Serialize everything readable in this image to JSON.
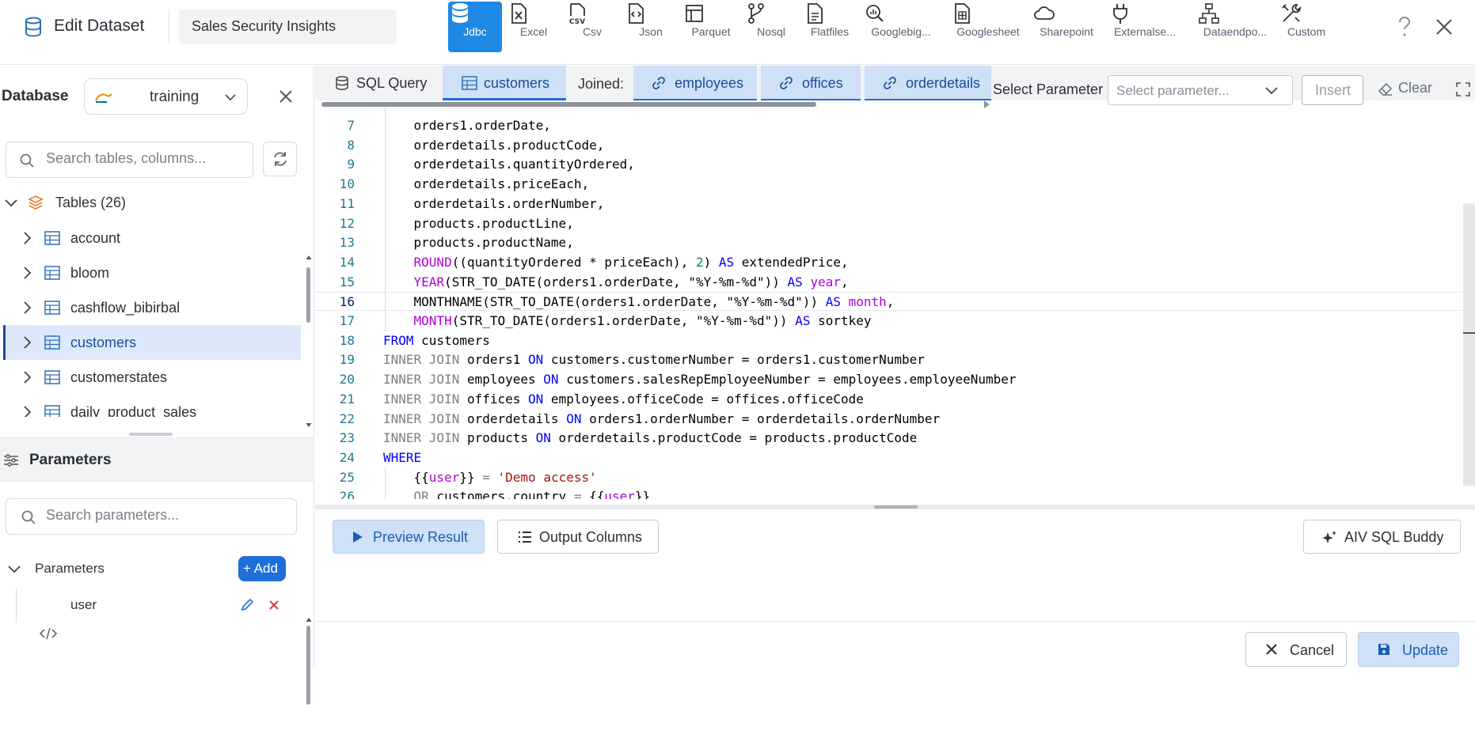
{
  "header": {
    "title": "Edit Dataset",
    "dataset_name": "Sales Security Insights",
    "sources": [
      {
        "label": "Jdbc",
        "icon": "database-icon",
        "active": true
      },
      {
        "label": "Excel",
        "icon": "excel-file-icon"
      },
      {
        "label": "Csv",
        "icon": "csv-file-icon"
      },
      {
        "label": "Json",
        "icon": "json-file-icon"
      },
      {
        "label": "Parquet",
        "icon": "parquet-icon"
      },
      {
        "label": "Nosql",
        "icon": "nosql-branch-icon"
      },
      {
        "label": "Flatfiles",
        "icon": "flatfile-icon"
      },
      {
        "label": "Googlebig...",
        "icon": "googlebigquery-icon"
      },
      {
        "label": "Googlesheet",
        "icon": "googlesheet-icon"
      },
      {
        "label": "Sharepoint",
        "icon": "sharepoint-cloud-icon"
      },
      {
        "label": "Externalse...",
        "icon": "plug-icon"
      },
      {
        "label": "Dataendpo...",
        "icon": "dataendpoint-icon"
      },
      {
        "label": "Custom",
        "icon": "tools-icon"
      }
    ]
  },
  "left": {
    "database_label": "Database",
    "database_value": "training",
    "table_search_placeholder": "Search tables, columns...",
    "tables_header": "Tables (26)",
    "tables": [
      {
        "label": "account"
      },
      {
        "label": "bloom"
      },
      {
        "label": "cashflow_bibirbal"
      },
      {
        "label": "customers",
        "selected": true
      },
      {
        "label": "customerstates"
      },
      {
        "label": "daily_product_sales"
      }
    ],
    "parameters_title": "Parameters",
    "param_search_placeholder": "Search parameters...",
    "param_group_label": "Parameters",
    "add_label": "+ Add",
    "params": [
      {
        "label": "user"
      }
    ]
  },
  "editor_tabs": {
    "sql_query": "SQL Query",
    "main_table": "customers",
    "joined_label": "Joined:",
    "joined": [
      "employees",
      "offices",
      "orderdetails"
    ],
    "select_parameter_label": "Select Parameter",
    "select_parameter_placeholder": "Select parameter...",
    "insert_label": "Insert",
    "clear_label": "Clear"
  },
  "code": {
    "current_line": 16,
    "lines": [
      {
        "n": 7,
        "tokens": [
          [
            "t",
            "    orders1.orderDate,"
          ]
        ]
      },
      {
        "n": 8,
        "tokens": [
          [
            "t",
            "    orderdetails.productCode,"
          ]
        ]
      },
      {
        "n": 9,
        "tokens": [
          [
            "t",
            "    orderdetails.quantityOrdered,"
          ]
        ]
      },
      {
        "n": 10,
        "tokens": [
          [
            "t",
            "    orderdetails.priceEach,"
          ]
        ]
      },
      {
        "n": 11,
        "tokens": [
          [
            "t",
            "    orderdetails.orderNumber,"
          ]
        ]
      },
      {
        "n": 12,
        "tokens": [
          [
            "t",
            "    products.productLine,"
          ]
        ]
      },
      {
        "n": 13,
        "tokens": [
          [
            "t",
            "    products.productName,"
          ]
        ]
      },
      {
        "n": 14,
        "tokens": [
          [
            "t",
            "    "
          ],
          [
            "fn",
            "ROUND"
          ],
          [
            "t",
            "((quantityOrdered * priceEach), "
          ],
          [
            "num",
            "2"
          ],
          [
            "t",
            ") "
          ],
          [
            "kw",
            "AS"
          ],
          [
            "t",
            " extendedPrice,"
          ]
        ]
      },
      {
        "n": 15,
        "tokens": [
          [
            "t",
            "    "
          ],
          [
            "fn",
            "YEAR"
          ],
          [
            "t",
            "(STR_TO_DATE(orders1.orderDate, \"%Y-%m-%d\")) "
          ],
          [
            "kw",
            "AS"
          ],
          [
            "t",
            " "
          ],
          [
            "fn",
            "year"
          ],
          [
            "t",
            ","
          ]
        ]
      },
      {
        "n": 16,
        "tokens": [
          [
            "t",
            "    MONTHNAME(STR_TO_DATE(orders1.orderDate, \"%Y-%m-%d\")) "
          ],
          [
            "kw",
            "AS"
          ],
          [
            "t",
            " "
          ],
          [
            "fn",
            "month"
          ],
          [
            "t",
            ","
          ]
        ]
      },
      {
        "n": 17,
        "tokens": [
          [
            "t",
            "    "
          ],
          [
            "fn",
            "MONTH"
          ],
          [
            "t",
            "(STR_TO_DATE(orders1.orderDate, \"%Y-%m-%d\")) "
          ],
          [
            "kw",
            "AS"
          ],
          [
            "t",
            " sortkey"
          ]
        ]
      },
      {
        "n": 18,
        "tokens": [
          [
            "kw",
            "FROM"
          ],
          [
            "t",
            " customers"
          ]
        ]
      },
      {
        "n": 19,
        "tokens": [
          [
            "kwg",
            "INNER JOIN"
          ],
          [
            "t",
            " orders1 "
          ],
          [
            "kw",
            "ON"
          ],
          [
            "t",
            " customers.customerNumber = orders1.customerNumber"
          ]
        ]
      },
      {
        "n": 20,
        "tokens": [
          [
            "kwg",
            "INNER JOIN"
          ],
          [
            "t",
            " employees "
          ],
          [
            "kw",
            "ON"
          ],
          [
            "t",
            " customers.salesRepEmployeeNumber = employees.employeeNumber"
          ]
        ]
      },
      {
        "n": 21,
        "tokens": [
          [
            "kwg",
            "INNER JOIN"
          ],
          [
            "t",
            " offices "
          ],
          [
            "kw",
            "ON"
          ],
          [
            "t",
            " employees.officeCode = offices.officeCode"
          ]
        ]
      },
      {
        "n": 22,
        "tokens": [
          [
            "kwg",
            "INNER JOIN"
          ],
          [
            "t",
            " orderdetails "
          ],
          [
            "kw",
            "ON"
          ],
          [
            "t",
            " orders1.orderNumber = orderdetails.orderNumber"
          ]
        ]
      },
      {
        "n": 23,
        "tokens": [
          [
            "kwg",
            "INNER JOIN"
          ],
          [
            "t",
            " products "
          ],
          [
            "kw",
            "ON"
          ],
          [
            "t",
            " orderdetails.productCode = products.productCode"
          ]
        ]
      },
      {
        "n": 24,
        "tokens": [
          [
            "kw",
            "WHERE"
          ]
        ]
      },
      {
        "n": 25,
        "tokens": [
          [
            "t",
            "    {{"
          ],
          [
            "fn",
            "user"
          ],
          [
            "t",
            "}} "
          ],
          [
            "kwg",
            "="
          ],
          [
            "t",
            " "
          ],
          [
            "str",
            "'Demo access'"
          ]
        ]
      },
      {
        "n": 26,
        "tokens": [
          [
            "t",
            "    "
          ],
          [
            "kwg",
            "OR"
          ],
          [
            "t",
            " customers.country "
          ],
          [
            "kwg",
            "="
          ],
          [
            "t",
            " {{"
          ],
          [
            "fn",
            "user"
          ],
          [
            "t",
            "}}"
          ]
        ]
      }
    ]
  },
  "actions": {
    "preview": "Preview Result",
    "output_columns": "Output Columns",
    "sql_buddy": "AIV SQL Buddy",
    "cancel": "Cancel",
    "update": "Update"
  },
  "colors": {
    "accent": "#1e88e5",
    "selected_bg": "#dde9fb",
    "tab_bg": "#cfe0f7"
  }
}
